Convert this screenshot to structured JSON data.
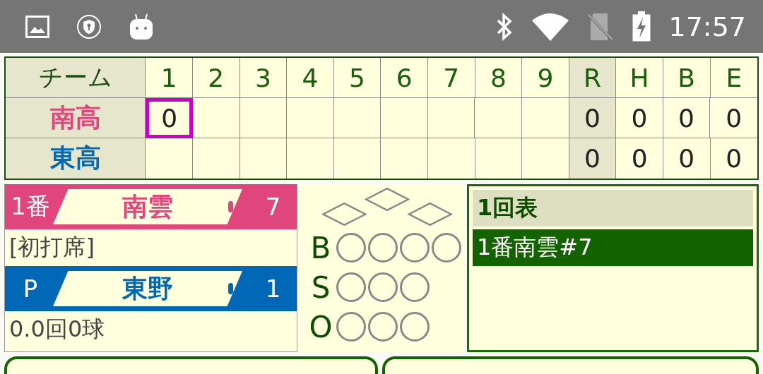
{
  "status_bar": {
    "time": "17:57"
  },
  "scoreboard": {
    "team_header": "チーム",
    "innings": [
      "1",
      "2",
      "3",
      "4",
      "5",
      "6",
      "7",
      "8",
      "9"
    ],
    "totals": [
      "R",
      "H",
      "B",
      "E"
    ],
    "rows": [
      {
        "team": "南高",
        "color": "#e0457b",
        "innings": [
          {
            "score": "0",
            "current": true
          }
        ],
        "totals": [
          "0",
          "0",
          "0",
          "0"
        ]
      },
      {
        "team": "東高",
        "color": "#0068b7",
        "innings": [],
        "totals": [
          "0",
          "0",
          "0",
          "0"
        ]
      }
    ]
  },
  "players": [
    {
      "role": "1番",
      "name": "南雲",
      "number": "7",
      "color": "#e0457b",
      "detail": "[初打席]"
    },
    {
      "role": "P",
      "name": "東野",
      "number": "1",
      "color": "#0068b7",
      "detail": "0.0回0球"
    }
  ],
  "bases": [
    {
      "occupied": false
    },
    {
      "occupied": false
    },
    {
      "occupied": false
    }
  ],
  "count": [
    {
      "label": "B",
      "lights": [
        {
          "on": false
        },
        {
          "on": false
        },
        {
          "on": false
        },
        {
          "on": false
        }
      ]
    },
    {
      "label": "S",
      "lights": [
        {
          "on": false
        },
        {
          "on": false
        },
        {
          "on": false
        }
      ]
    },
    {
      "label": "O",
      "lights": [
        {
          "on": false
        },
        {
          "on": false
        },
        {
          "on": false
        }
      ]
    }
  ],
  "play_log": {
    "title": "1回表",
    "entries": [
      {
        "text": "1番南雲#7",
        "selected": true
      }
    ]
  }
}
